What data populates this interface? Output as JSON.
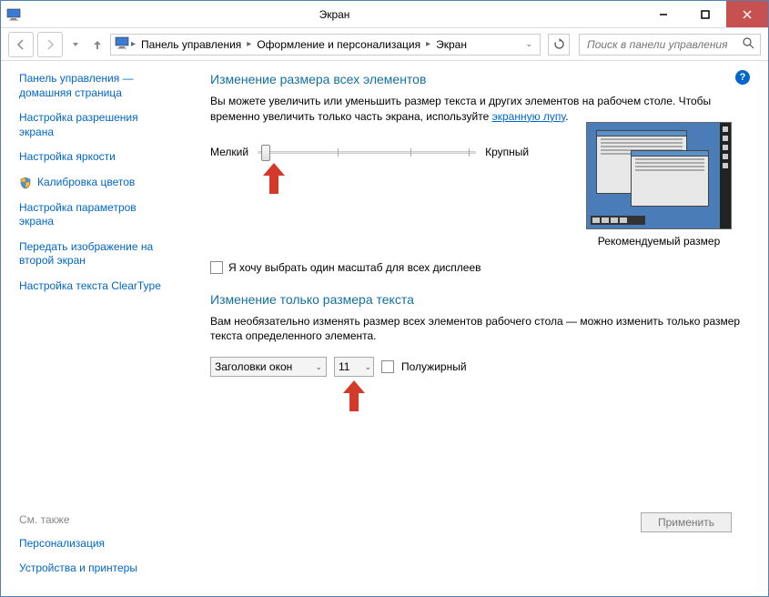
{
  "window": {
    "title": "Экран"
  },
  "breadcrumb": {
    "root": "Панель управления",
    "mid": "Оформление и персонализация",
    "leaf": "Экран"
  },
  "search": {
    "placeholder": "Поиск в панели управления"
  },
  "sidebar": {
    "home1": "Панель управления —",
    "home2": "домашняя страница",
    "link1a": "Настройка разрешения",
    "link1b": "экрана",
    "link2": "Настройка яркости",
    "link3": "Калибровка цветов",
    "link4a": "Настройка параметров",
    "link4b": "экрана",
    "link5a": "Передать изображение на",
    "link5b": "второй экран",
    "link6": "Настройка текста ClearType",
    "seealso": "См. также",
    "foot1": "Персонализация",
    "foot2": "Устройства и принтеры"
  },
  "main": {
    "heading1": "Изменение размера всех элементов",
    "para1a": "Вы можете увеличить или уменьшить размер текста и других элементов на рабочем столе. Чтобы временно увеличить только часть экрана, используйте ",
    "para1link": "экранную лупу",
    "slider_small": "Мелкий",
    "slider_large": "Крупный",
    "preview_caption": "Рекомендуемый размер",
    "chk_label": "Я хочу выбрать один масштаб для всех дисплеев",
    "heading2": "Изменение только размера текста",
    "para2": "Вам необязательно изменять размер всех элементов рабочего стола — можно изменить только размер текста определенного элемента.",
    "dd_element": "Заголовки окон",
    "dd_size": "11",
    "chk_bold": "Полужирный",
    "apply": "Применить"
  }
}
